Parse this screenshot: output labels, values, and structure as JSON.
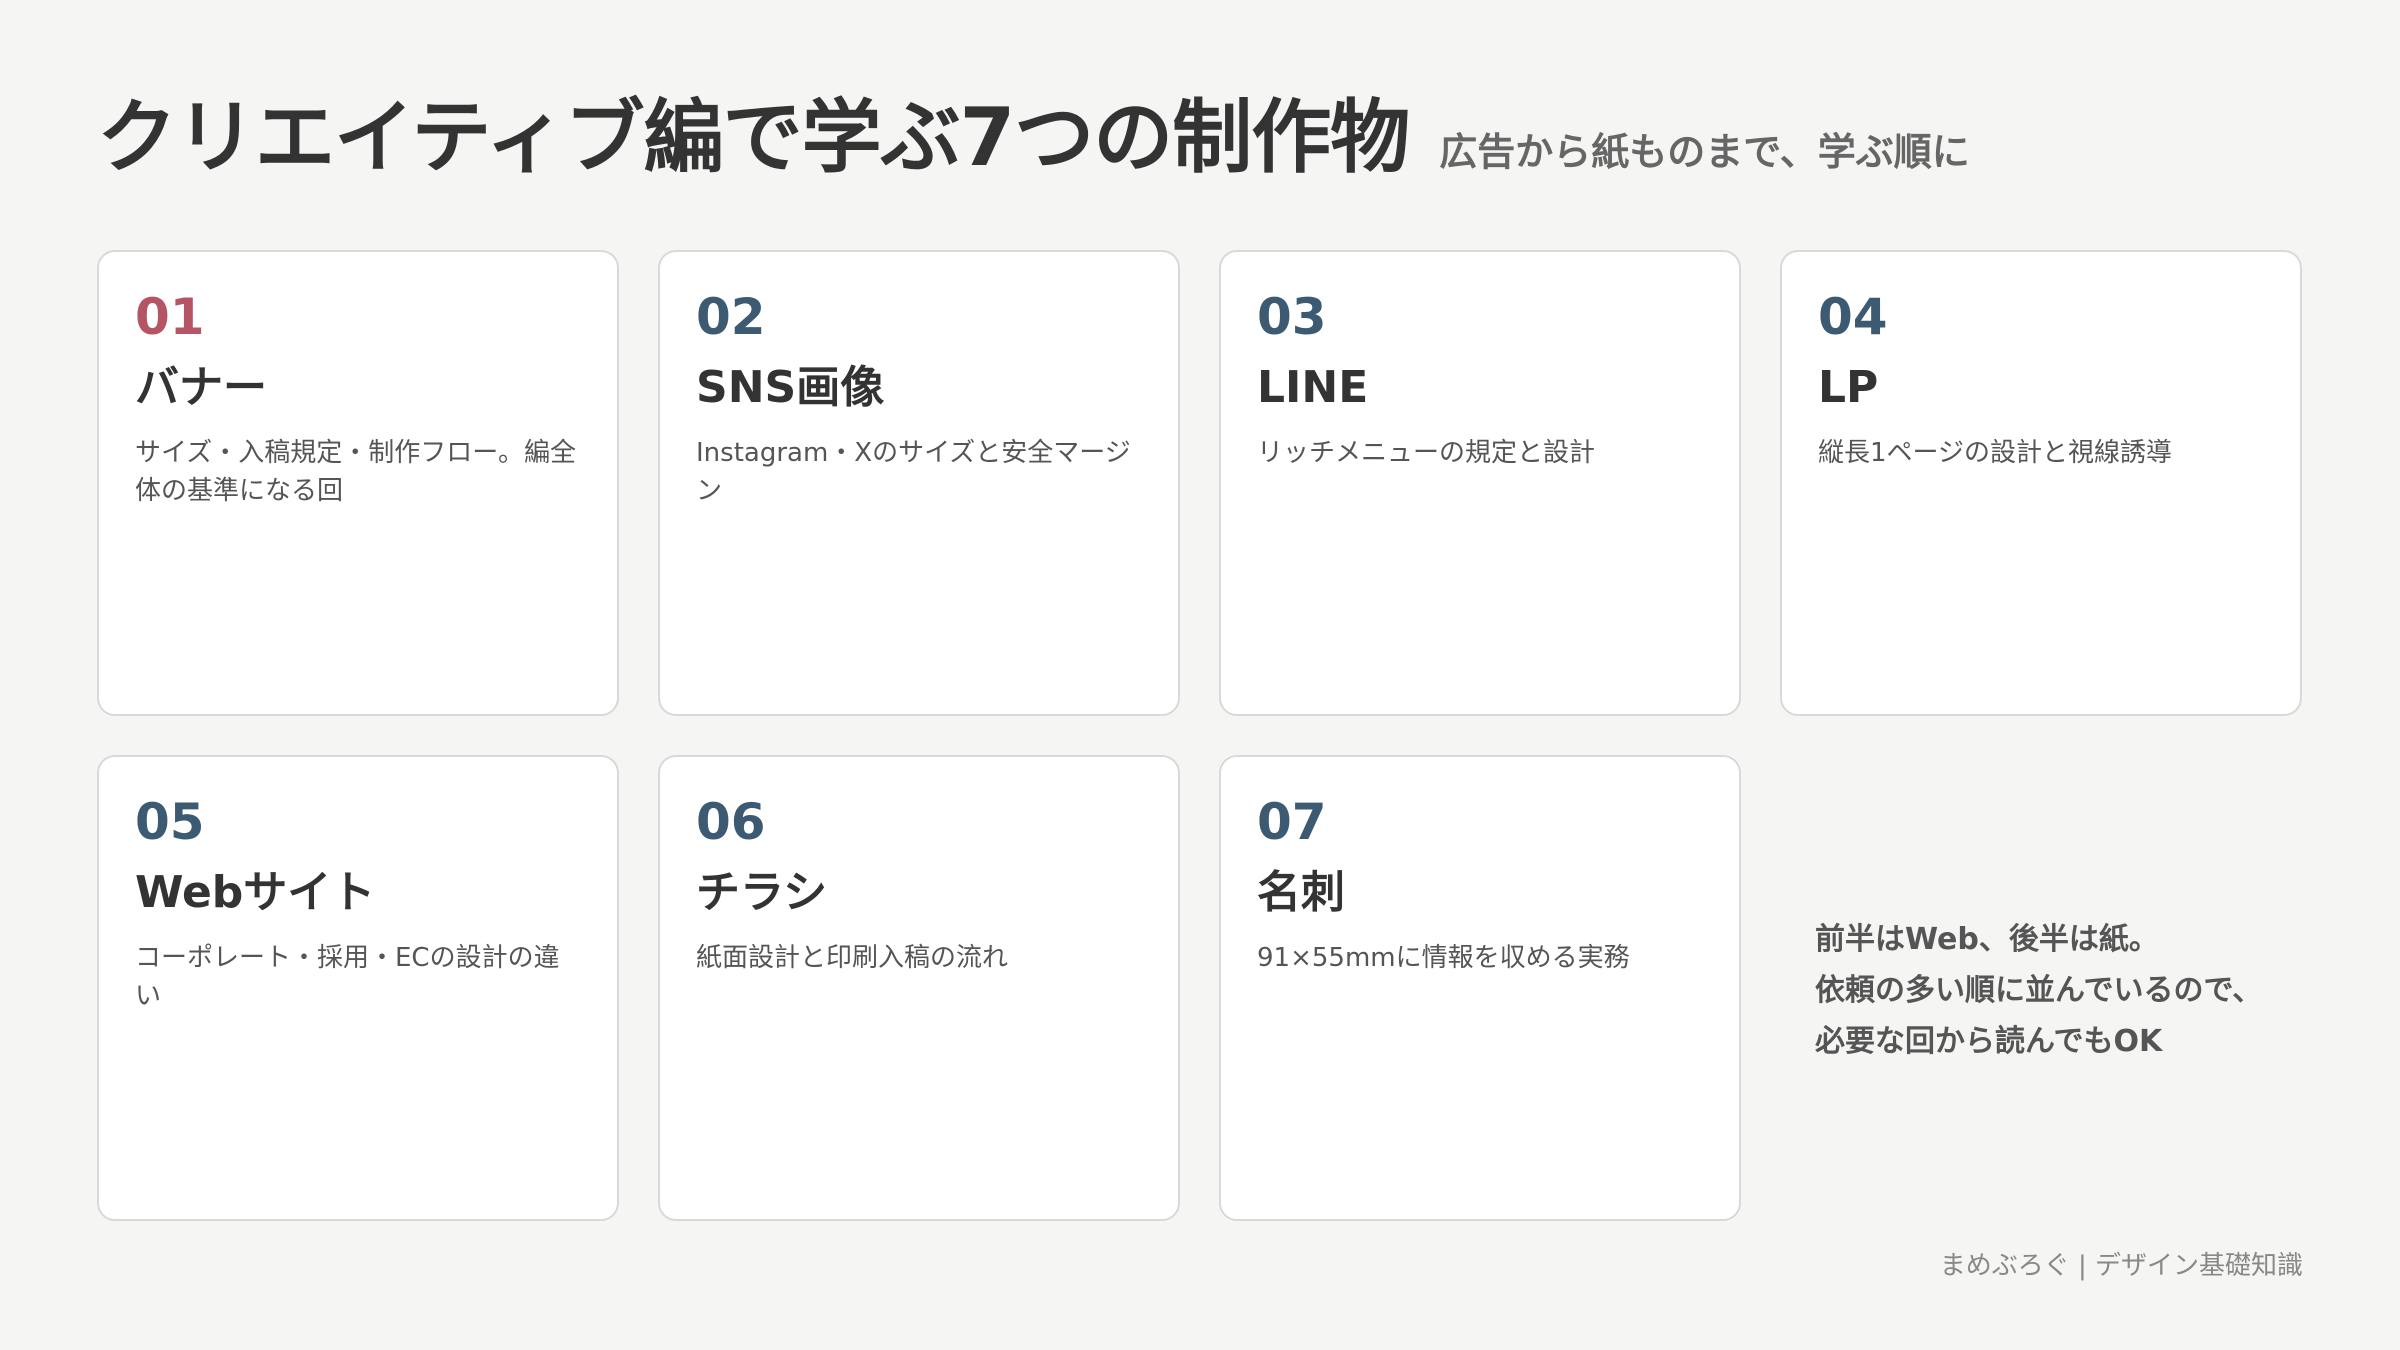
{
  "header": {
    "title": "クリエイティブ編で学ぶ7つの制作物",
    "subtitle": "広告から紙ものまで、学ぶ順に"
  },
  "colors": {
    "accent_first": "#b55464",
    "accent_number": "#3d5a73",
    "background": "#f5f5f3",
    "card_border": "#d9d9d9"
  },
  "cards": [
    {
      "number": "01",
      "title": "バナー",
      "desc": "サイズ・入稿規定・制作フロー。編全体の基準になる回"
    },
    {
      "number": "02",
      "title": "SNS画像",
      "desc": "Instagram・Xのサイズと安全マージン"
    },
    {
      "number": "03",
      "title": "LINE",
      "desc": "リッチメニューの規定と設計"
    },
    {
      "number": "04",
      "title": "LP",
      "desc": "縦長1ページの設計と視線誘導"
    },
    {
      "number": "05",
      "title": "Webサイト",
      "desc": "コーポレート・採用・ECの設計の違い"
    },
    {
      "number": "06",
      "title": "チラシ",
      "desc": "紙面設計と印刷入稿の流れ"
    },
    {
      "number": "07",
      "title": "名刺",
      "desc": "91×55mmに情報を収める実務"
    }
  ],
  "note": {
    "line1": "前半はWeb、後半は紙。",
    "line2": "依頼の多い順に並んでいるので、",
    "line3": "必要な回から読んでもOK"
  },
  "footer": {
    "text": "まめぶろぐ | デザイン基礎知識"
  }
}
